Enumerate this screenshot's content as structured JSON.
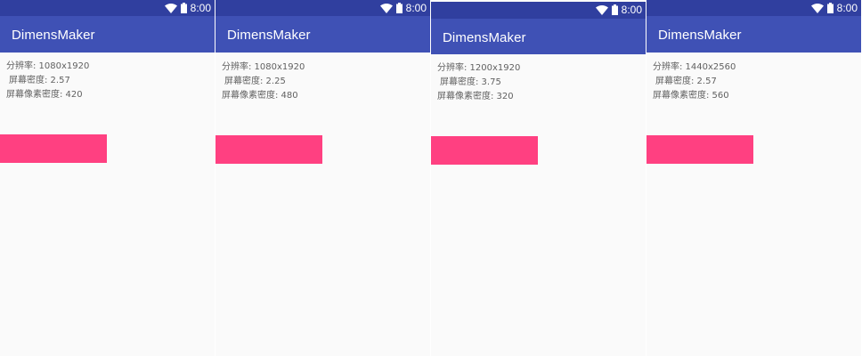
{
  "status": {
    "time": "8:00"
  },
  "app": {
    "title": "DimensMaker"
  },
  "screens": [
    {
      "resolution": "分辨率: 1080x1920",
      "density": "屏幕密度: 2.57",
      "dpi": "屏幕像素密度: 420"
    },
    {
      "resolution": "分辨率: 1080x1920",
      "density": "屏幕密度: 2.25",
      "dpi": "屏幕像素密度: 480"
    },
    {
      "resolution": "分辨率: 1200x1920",
      "density": "屏幕密度: 3.75",
      "dpi": "屏幕像素密度: 320"
    },
    {
      "resolution": "分辨率: 1440x2560",
      "density": "屏幕密度: 2.57",
      "dpi": "屏幕像素密度: 560"
    }
  ],
  "colors": {
    "status_bar": "#303f9f",
    "app_bar": "#3f51b5",
    "accent_block": "#ff4081",
    "background": "#fafafa"
  },
  "icons": {
    "wifi": "wifi-icon",
    "battery": "battery-icon"
  }
}
